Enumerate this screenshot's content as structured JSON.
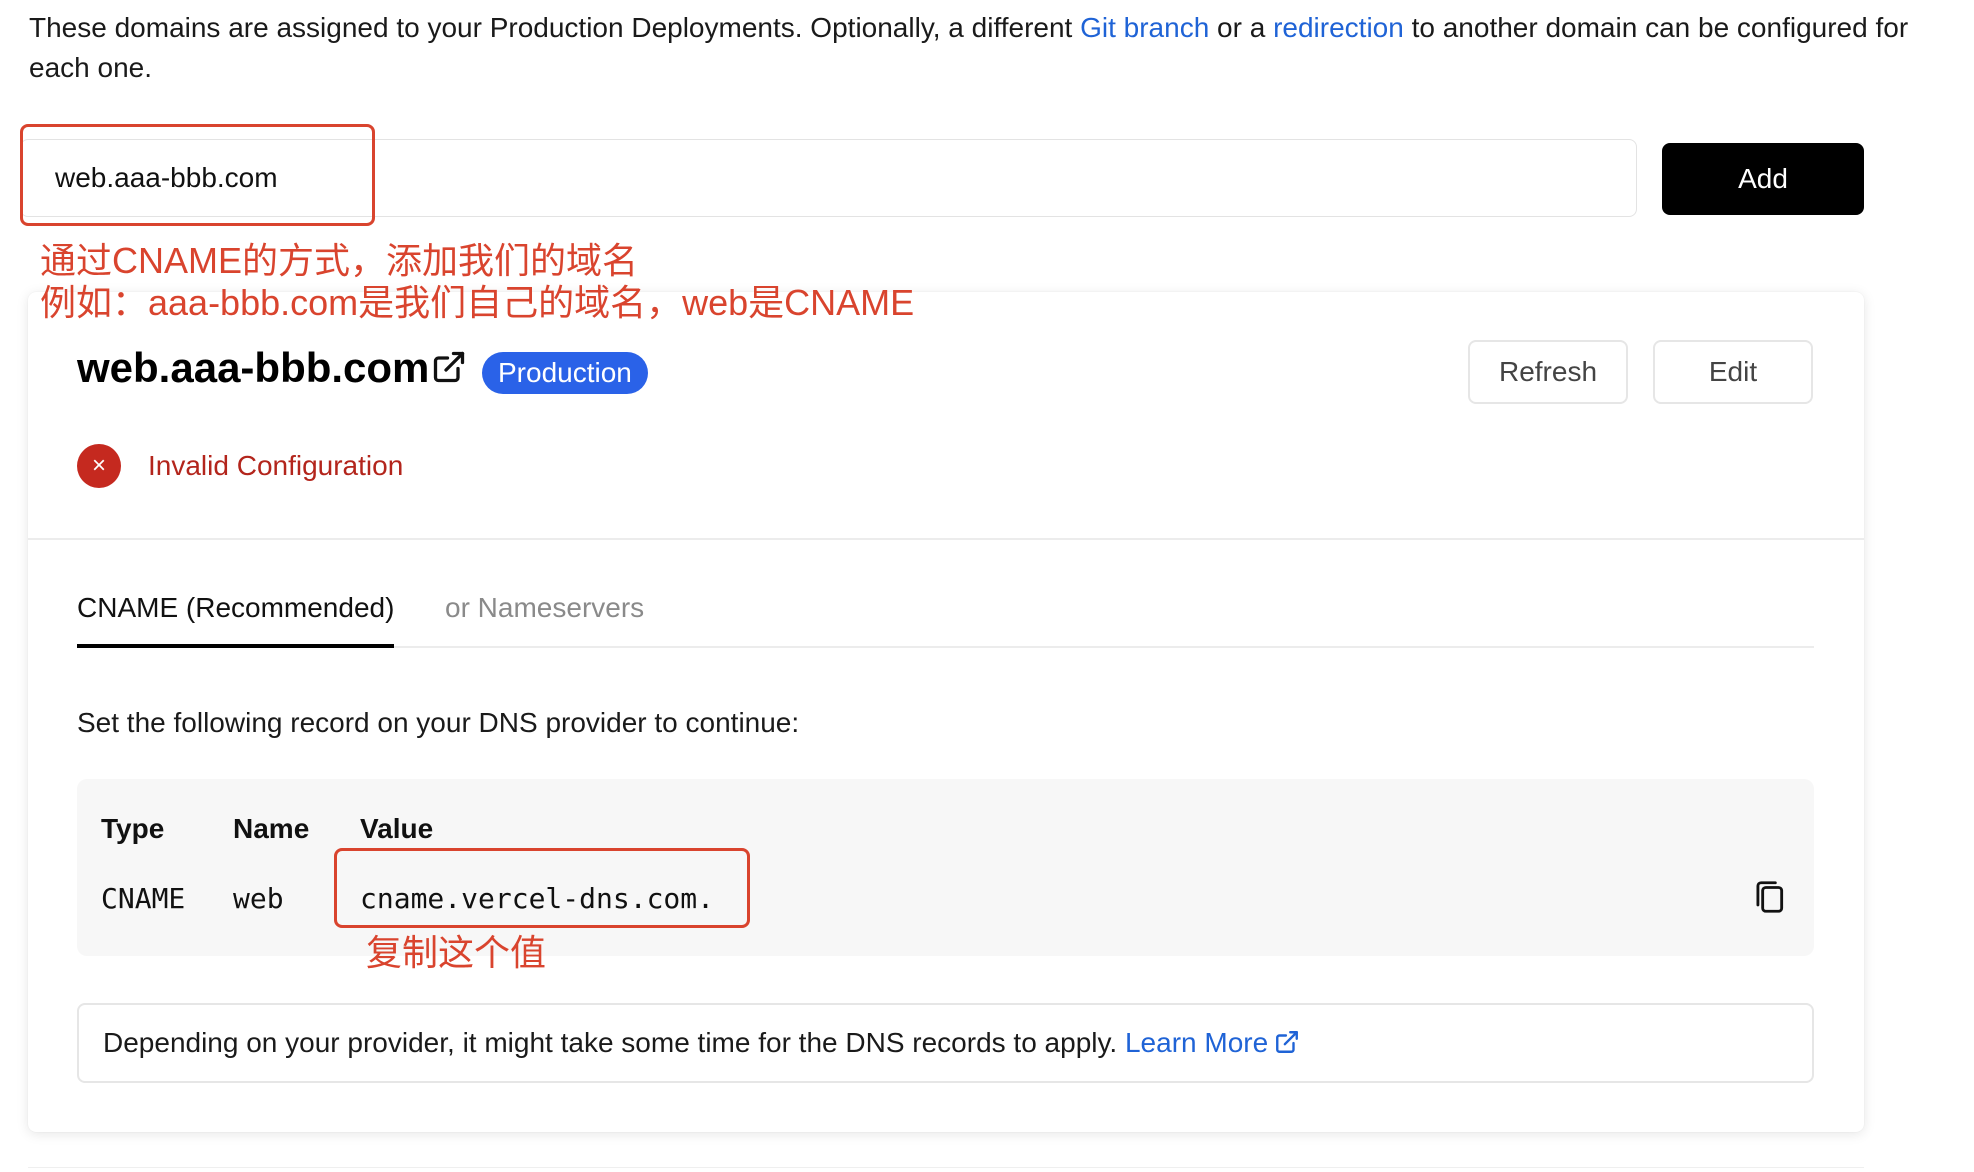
{
  "intro": {
    "text_before": "These domains are assigned to your Production Deployments. Optionally, a different ",
    "link_git_branch": "Git branch",
    "text_middle": " or a ",
    "link_redirection": "redirection",
    "text_after": " to another domain can be configured for each one."
  },
  "add_domain": {
    "input_value": "web.aaa-bbb.com",
    "button_label": "Add"
  },
  "annotations": {
    "line1": "通过CNAME的方式，添加我们的域名",
    "line2": "例如：aaa-bbb.com是我们自己的域名，web是CNAME",
    "copy_hint": "复制这个值",
    "color": "#d9442e"
  },
  "domain_card": {
    "domain": "web.aaa-bbb.com",
    "badge": "Production",
    "refresh_label": "Refresh",
    "edit_label": "Edit",
    "status": "Invalid Configuration",
    "status_icon": "×",
    "tabs": [
      {
        "label": "CNAME (Recommended)",
        "active": true
      },
      {
        "label": "or Nameservers",
        "active": false
      }
    ],
    "instruction": "Set the following record on your DNS provider to continue:",
    "record": {
      "headers": {
        "type": "Type",
        "name": "Name",
        "value": "Value"
      },
      "type": "CNAME",
      "name": "web",
      "value": "cname.vercel-dns.com."
    },
    "note_text": "Depending on your provider, it might take some time for the DNS records to apply. ",
    "note_link": "Learn More"
  },
  "colors": {
    "link": "#1f63d6",
    "badge": "#2a62e8",
    "error": "#c5291f",
    "primary_button": "#000000"
  },
  "icons": {
    "title_link": "external-link-icon",
    "status": "error-circle-x-icon",
    "copy": "copy-icon",
    "learn_more": "external-link-icon"
  }
}
